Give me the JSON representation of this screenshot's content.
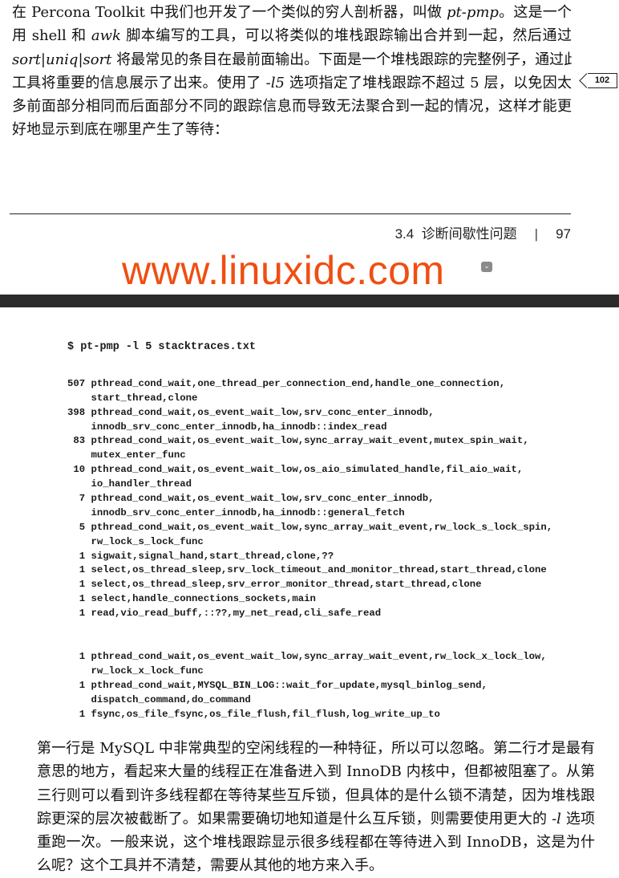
{
  "top_paragraph": [
    [
      {
        "t": "在 Percona Toolkit 中我们也开发了一个类似的穷人剖析器，叫做 "
      },
      {
        "t": "pt-pmp",
        "i": true
      },
      {
        "t": "。这是一个"
      }
    ],
    [
      {
        "t": "用 shell 和 "
      },
      {
        "t": "awk",
        "i": true
      },
      {
        "t": " 脚本编写的工具，可以将类似的堆栈跟踪输出合并到一起，然后通过"
      }
    ],
    [
      {
        "t": "sort|uniq|sort",
        "i": true
      },
      {
        "t": " 将最常见的条目在最前面输出。下面是一个堆栈跟踪的完整例子，通过此"
      }
    ],
    [
      {
        "t": "工具将重要的信息展示了出来。使用了 "
      },
      {
        "t": "-l5",
        "i": true
      },
      {
        "t": " 选项指定了堆栈跟踪不超过 5 层，以免因太"
      }
    ],
    [
      {
        "t": "多前面部分相同而后面部分不同的跟踪信息而导致无法聚合到一起的情况，这样才能更"
      }
    ],
    [
      {
        "t": "好地显示到底在哪里产生了等待："
      }
    ]
  ],
  "margin_note": "102",
  "running_head": {
    "section": "3.4  诊断间歇性问题",
    "separator": "|",
    "page": "97"
  },
  "watermark": {
    "text": "www.linuxidc.com",
    "color": "#f04e12"
  },
  "code": {
    "command": "$ pt-pmp -l 5 stacktraces.txt",
    "group1": [
      "507 pthread_cond_wait,one_thread_per_connection_end,handle_one_connection,",
      "    start_thread,clone",
      "398 pthread_cond_wait,os_event_wait_low,srv_conc_enter_innodb,",
      "    innodb_srv_conc_enter_innodb,ha_innodb::index_read",
      " 83 pthread_cond_wait,os_event_wait_low,sync_array_wait_event,mutex_spin_wait,",
      "    mutex_enter_func",
      " 10 pthread_cond_wait,os_event_wait_low,os_aio_simulated_handle,fil_aio_wait,",
      "    io_handler_thread",
      "  7 pthread_cond_wait,os_event_wait_low,srv_conc_enter_innodb,",
      "    innodb_srv_conc_enter_innodb,ha_innodb::general_fetch",
      "  5 pthread_cond_wait,os_event_wait_low,sync_array_wait_event,rw_lock_s_lock_spin,",
      "    rw_lock_s_lock_func",
      "  1 sigwait,signal_hand,start_thread,clone,??",
      "  1 select,os_thread_sleep,srv_lock_timeout_and_monitor_thread,start_thread,clone",
      "  1 select,os_thread_sleep,srv_error_monitor_thread,start_thread,clone",
      "  1 select,handle_connections_sockets,main",
      "  1 read,vio_read_buff,::??,my_net_read,cli_safe_read"
    ],
    "group2": [
      "  1 pthread_cond_wait,os_event_wait_low,sync_array_wait_event,rw_lock_x_lock_low,",
      "    rw_lock_x_lock_func",
      "  1 pthread_cond_wait,MYSQL_BIN_LOG::wait_for_update,mysql_binlog_send,",
      "    dispatch_command,do_command",
      "  1 fsync,os_file_fsync,os_file_flush,fil_flush,log_write_up_to"
    ]
  },
  "bottom_paragraph": [
    [
      {
        "t": "第一行是 MySQL 中非常典型的空闲线程的一种特征，所以可以忽略。第二行才是最有"
      }
    ],
    [
      {
        "t": "意思的地方，看起来大量的线程正在准备进入到 InnoDB 内核中，但都被阻塞了。从第"
      }
    ],
    [
      {
        "t": "三行则可以看到许多线程都在等待某些互斥锁，但具体的是什么锁不清楚，因为堆栈跟"
      }
    ],
    [
      {
        "t": "踪更深的层次被截断了。如果需要确切地知道是什么互斥锁，则需要使用更大的 "
      },
      {
        "t": "-l",
        "i": true
      },
      {
        "t": " 选项"
      }
    ],
    [
      {
        "t": "重跑一次。一般来说，这个堆栈跟踪显示很多线程都在等待进入到 InnoDB，这是为什"
      }
    ],
    [
      {
        "t": "么呢？这个工具并不清楚，需要从其他的地方来入手。"
      }
    ]
  ]
}
